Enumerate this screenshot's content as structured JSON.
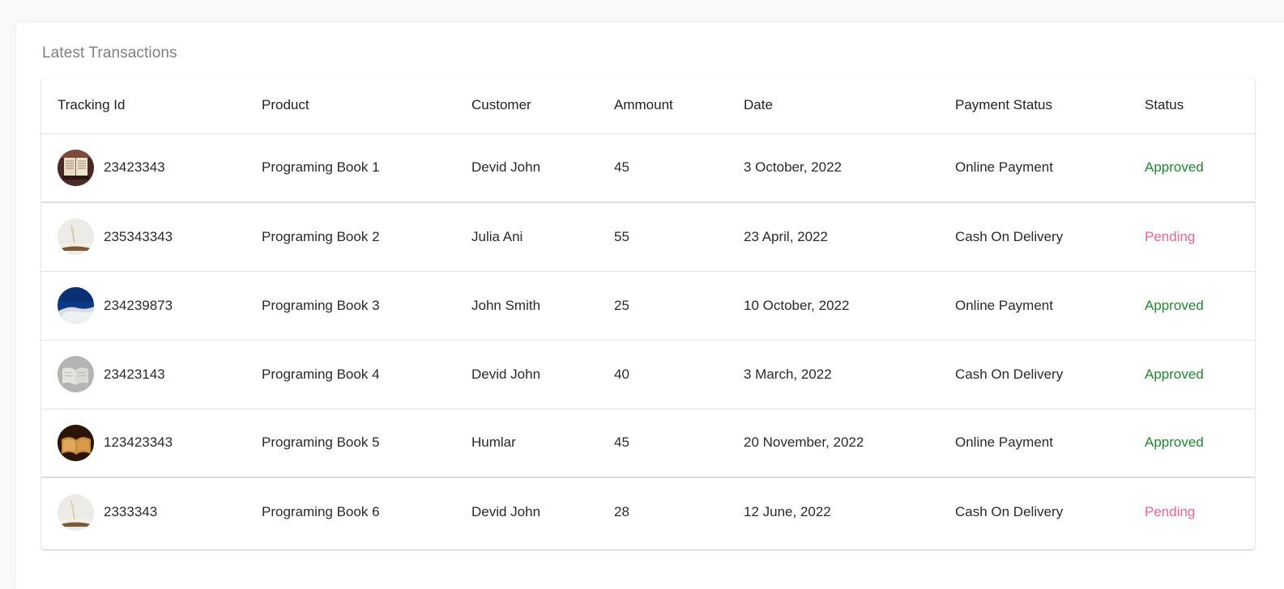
{
  "title": "Latest Transactions",
  "columns": [
    "Tracking Id",
    "Product",
    "Customer",
    "Ammount",
    "Date",
    "Payment Status",
    "Status"
  ],
  "colors": {
    "approved": "#1e8a2e",
    "pending": "#f06292"
  },
  "rows": [
    {
      "thumb": "open-book-dark-image",
      "tracking_id": "23423343",
      "product": "Programing Book 1",
      "customer": "Devid John",
      "amount": "45",
      "date": "3 October, 2022",
      "payment": "Online Payment",
      "status": "Approved",
      "status_kind": "approved"
    },
    {
      "thumb": "book-with-feather-image",
      "tracking_id": "235343343",
      "product": "Programing Book 2",
      "customer": "Julia Ani",
      "amount": "55",
      "date": "23 April, 2022",
      "payment": "Cash On Delivery",
      "status": "Pending",
      "status_kind": "pending"
    },
    {
      "thumb": "blue-sky-book-image",
      "tracking_id": "234239873",
      "product": "Programing Book 3",
      "customer": "John Smith",
      "amount": "25",
      "date": "10 October, 2022",
      "payment": "Online Payment",
      "status": "Approved",
      "status_kind": "approved"
    },
    {
      "thumb": "grey-open-book-image",
      "tracking_id": "23423143",
      "product": "Programing Book 4",
      "customer": "Devid John",
      "amount": "40",
      "date": "3 March, 2022",
      "payment": "Cash On Delivery",
      "status": "Approved",
      "status_kind": "approved"
    },
    {
      "thumb": "golden-book-image",
      "tracking_id": "123423343",
      "product": "Programing Book 5",
      "customer": "Humlar",
      "amount": "45",
      "date": "20 November, 2022",
      "payment": "Online Payment",
      "status": "Approved",
      "status_kind": "approved"
    },
    {
      "thumb": "book-with-feather-image",
      "tracking_id": "2333343",
      "product": "Programing Book 6",
      "customer": "Devid John",
      "amount": "28",
      "date": "12 June, 2022",
      "payment": "Cash On Delivery",
      "status": "Pending",
      "status_kind": "pending"
    }
  ]
}
